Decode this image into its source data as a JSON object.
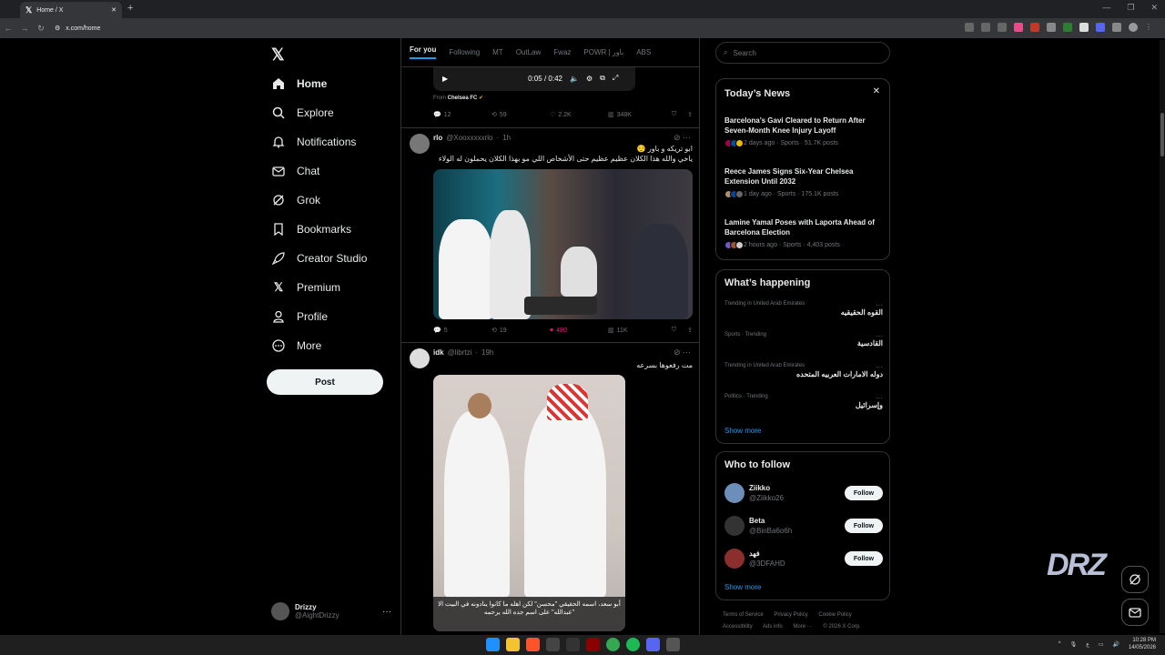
{
  "browser": {
    "tab_title": "Home / X",
    "url": "x.com/home"
  },
  "sidebar": {
    "logo": "X",
    "items": [
      {
        "label": "Home"
      },
      {
        "label": "Explore"
      },
      {
        "label": "Notifications"
      },
      {
        "label": "Chat"
      },
      {
        "label": "Grok"
      },
      {
        "label": "Bookmarks"
      },
      {
        "label": "Creator Studio"
      },
      {
        "label": "Premium"
      },
      {
        "label": "Profile"
      },
      {
        "label": "More"
      }
    ],
    "post_label": "Post",
    "account": {
      "name": "Drizzy",
      "handle": "@AightDrizzy"
    }
  },
  "feed": {
    "tabs": [
      "For you",
      "Following",
      "MT",
      "OutLaw",
      "Fwaz",
      "POWR | باور",
      "ABS"
    ],
    "video_post": {
      "time": "0:05 / 0:42",
      "from_prefix": "From",
      "from_name": "Chelsea FC",
      "replies": "12",
      "reposts": "59",
      "likes": "2.2K",
      "views": "348K"
    },
    "post1": {
      "name": "rlo",
      "handle": "@Xooxxxxxrlo",
      "time": "1h",
      "line1": "ابو تريكه و باور 😌",
      "line2": "ياخي والله هذا الكلان عظيم عظيم حتى الأشخاص اللي مو بهذا الكلان يحملون له الولاء",
      "replies": "5",
      "reposts": "19",
      "likes": "480",
      "views": "11K"
    },
    "post2": {
      "name": "idk",
      "handle": "@librtzi",
      "time": "19h",
      "text": "مت رفعوها بسرعه",
      "caption": "أبو سعد، اسمه الحقيقي \"محسن\" لكن اهله ما كانوا ينادونه في البيت الا \"عبدالله\" على اسم جده الله يرحمه"
    }
  },
  "right": {
    "search_placeholder": "Search",
    "news": {
      "title": "Today’s News",
      "items": [
        {
          "headline": "Barcelona’s Gavi Cleared to Return After Seven-Month Knee Injury Layoff",
          "meta": "2 days ago · Sports · 51.7K posts"
        },
        {
          "headline": "Reece James Signs Six-Year Chelsea Extension Until 2032",
          "meta": "1 day ago · Sports · 175.1K posts"
        },
        {
          "headline": "Lamine Yamal Poses with Laporta Ahead of Barcelona Election",
          "meta": "2 hours ago · Sports · 4,403 posts"
        }
      ]
    },
    "happening": {
      "title": "What’s happening",
      "items": [
        {
          "context": "Trending in United Arab Emirates",
          "name": "القوه الحقيقيه"
        },
        {
          "context": "Sports · Trending",
          "name": "القادسية"
        },
        {
          "context": "Trending in United Arab Emirates",
          "name": "دوله الامارات العربيه المتحده"
        },
        {
          "context": "Politics · Trending",
          "name": "وإسرائيل"
        }
      ],
      "show_more": "Show more"
    },
    "follow": {
      "title": "Who to follow",
      "items": [
        {
          "name": "Ziikko",
          "handle": "@Ziikko26",
          "button": "Follow"
        },
        {
          "name": "Beta",
          "handle": "@BinBa6o6h",
          "button": "Follow"
        },
        {
          "name": "فهد",
          "handle": "@3DFAHD",
          "button": "Follow"
        }
      ],
      "show_more": "Show more"
    },
    "footer": {
      "links": [
        "Terms of Service",
        "Privacy Policy",
        "Cookie Policy",
        "Accessibility",
        "Ads info",
        "More ···",
        "© 2026 X Corp."
      ]
    }
  },
  "overlay": {
    "watermark": "DRZ"
  },
  "taskbar": {
    "time": "10:28 PM",
    "date": "14/05/2026",
    "lang": "ع"
  }
}
